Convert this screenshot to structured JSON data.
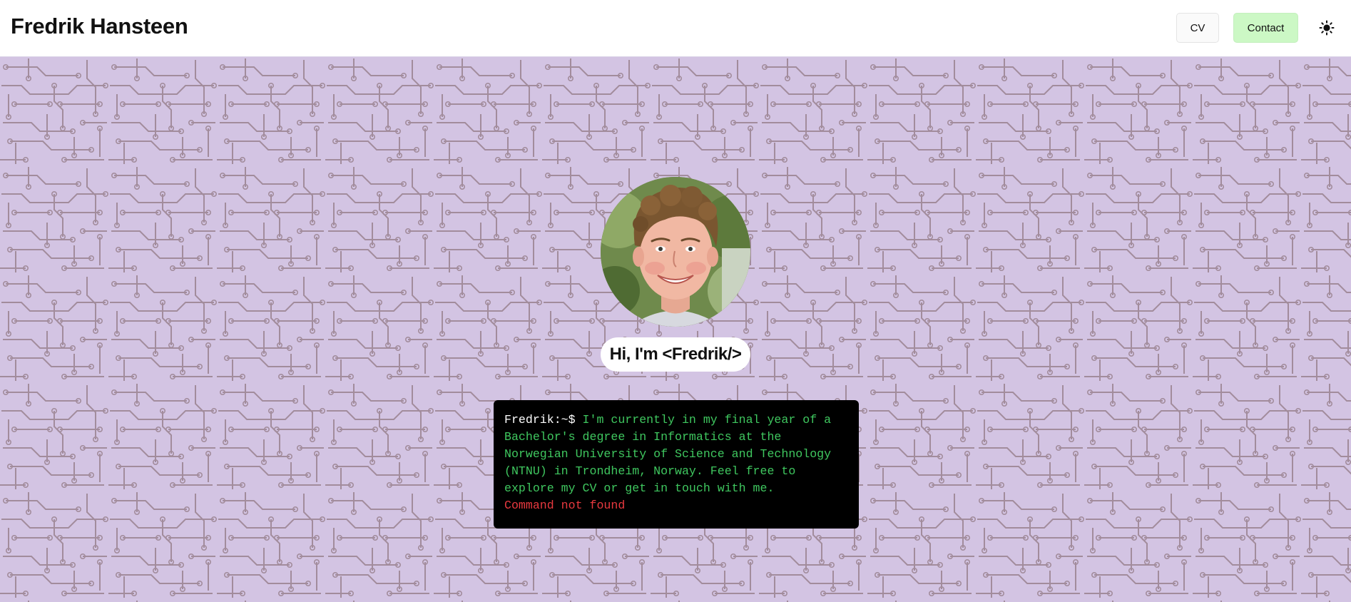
{
  "header": {
    "title": "Fredrik Hansteen",
    "cv_label": "CV",
    "contact_label": "Contact",
    "theme_icon": "sun-icon"
  },
  "hero": {
    "avatar_icon": "profile-photo",
    "greeting": "Hi, I'm <Fredrik/>",
    "terminal": {
      "prompt": "Fredrik:~$ ",
      "message": "I'm currently in my final year of a Bachelor's degree in Informatics at the Norwegian University of Science and Technology (NTNU) in Trondheim, Norway. Feel free to explore my CV or get in touch with me.",
      "error": "Command not found"
    }
  },
  "colors": {
    "background": "#d3c4e3",
    "circuit": "#a28c9c",
    "contact_button": "#ccf8c5",
    "terminal_bg": "#000000",
    "terminal_text": "#3fc75f",
    "terminal_error": "#e8393f"
  }
}
